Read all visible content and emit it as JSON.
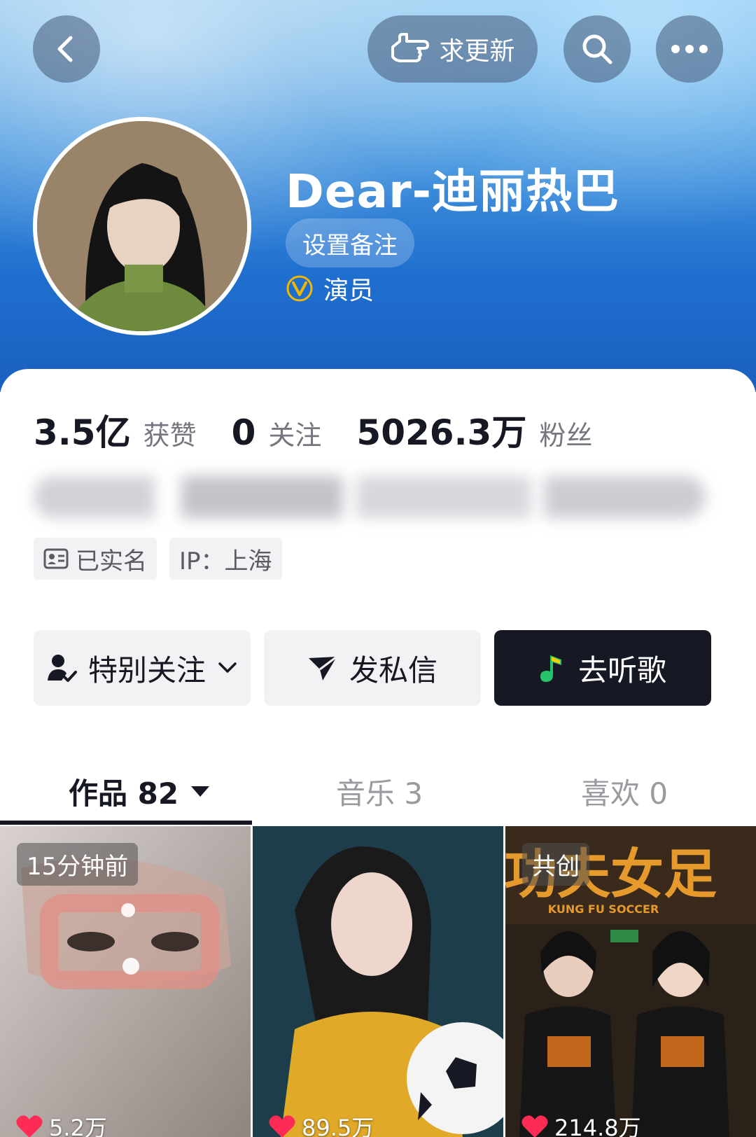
{
  "header": {
    "request_update_label": "求更新",
    "back_icon": "chevron-left-icon",
    "search_icon": "search-icon",
    "more_icon": "ellipsis-icon"
  },
  "profile": {
    "name": "Dear-迪丽热巴",
    "remark_button": "设置备注",
    "verify_label": "演员",
    "verify_badge": "V"
  },
  "stats": [
    {
      "value": "3.5亿",
      "label": "获赞"
    },
    {
      "value": "0",
      "label": "关注"
    },
    {
      "value": "5026.3万",
      "label": "粉丝"
    }
  ],
  "tags": {
    "real_name": "已实名",
    "ip": "IP：上海"
  },
  "actions": {
    "follow": "特别关注",
    "message": "发私信",
    "listen": "去听歌"
  },
  "tabs": [
    {
      "label": "作品 82"
    },
    {
      "label": "音乐 3"
    },
    {
      "label": "喜欢 0"
    }
  ],
  "videos": [
    {
      "badge": "15分钟前",
      "likes": "5.2万"
    },
    {
      "badge": "",
      "likes": "89.5万"
    },
    {
      "badge": "共创",
      "likes": "214.8万",
      "poster_title": "功夫女足",
      "poster_subtitle": "KUNG FU SOCCER"
    }
  ],
  "colors": {
    "accent_dark": "#161823",
    "like_red": "#fe2c55",
    "verify_gold": "#f5b800"
  }
}
